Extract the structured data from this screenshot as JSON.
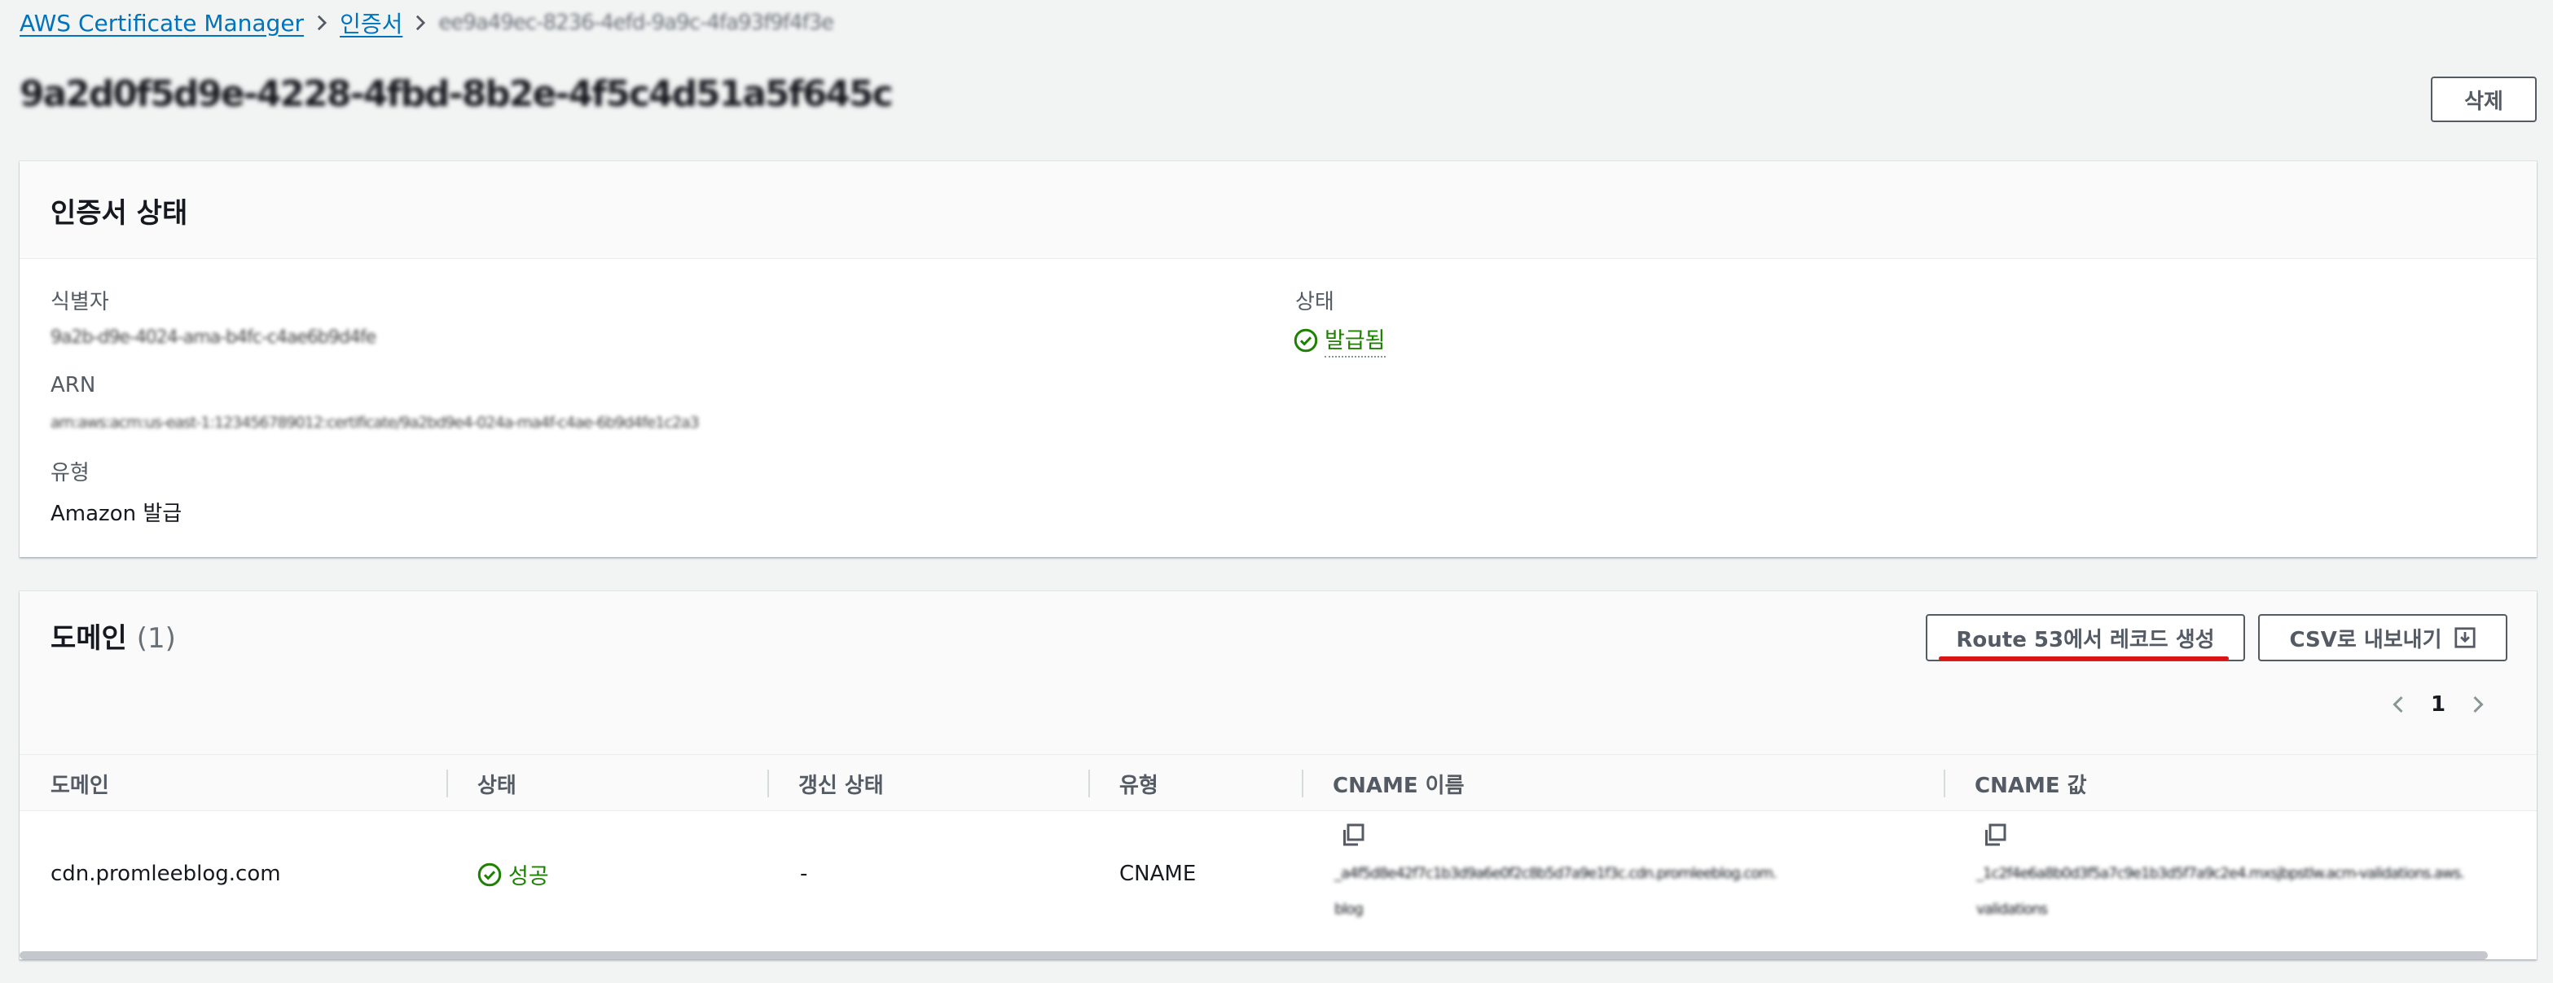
{
  "breadcrumb": {
    "items": [
      "AWS Certificate Manager",
      "인증서"
    ],
    "current": "ee9a49ec-8236-4efd-9a9c-4fa93f9f4f3e"
  },
  "page": {
    "title": "9a2d0f5d9e-4228-4fbd-8b2e-4f5c4d51a5f645c",
    "delete_label": "삭제"
  },
  "certificate_status": {
    "title": "인증서 상태",
    "identifier_label": "식별자",
    "identifier_value": "9a2b-d9e-4024-ama-b4fc-c4ae6b9d4fe",
    "arn_label": "ARN",
    "arn_value": "arn:aws:acm:us-east-1:123456789012:certificate/9a2bd9e4-024a-ma4f-c4ae-6b9d4fe1c2a3",
    "type_label": "유형",
    "type_value": "Amazon 발급",
    "status_label": "상태",
    "status_value": "발급됨"
  },
  "domains": {
    "title": "도메인",
    "count": "(1)",
    "route53_label": "Route 53에서 레코드 생성",
    "csv_label": "CSV로 내보내기",
    "page_number": "1",
    "columns": [
      "도메인",
      "상태",
      "갱신 상태",
      "유형",
      "CNAME 이름",
      "CNAME 값"
    ],
    "rows": [
      {
        "domain": "cdn.promleeblog.com",
        "status": "성공",
        "renewal": "-",
        "type": "CNAME",
        "cname_name_line1": "_a4f5d8e42f7c1b3d9a6e0f2c8b5d7a9e1f3c.cdn.promleeblog.com.",
        "cname_name_line2": "blog",
        "cname_value_line1": "_1c2f4e6a8b0d3f5a7c9e1b3d5f7a9c2e4.mxsjbpstlw.acm-validations.aws.",
        "cname_value_line2": "validations"
      }
    ]
  },
  "colors": {
    "link": "#0073bb",
    "success": "#1d8102",
    "highlight": "#d91515"
  }
}
